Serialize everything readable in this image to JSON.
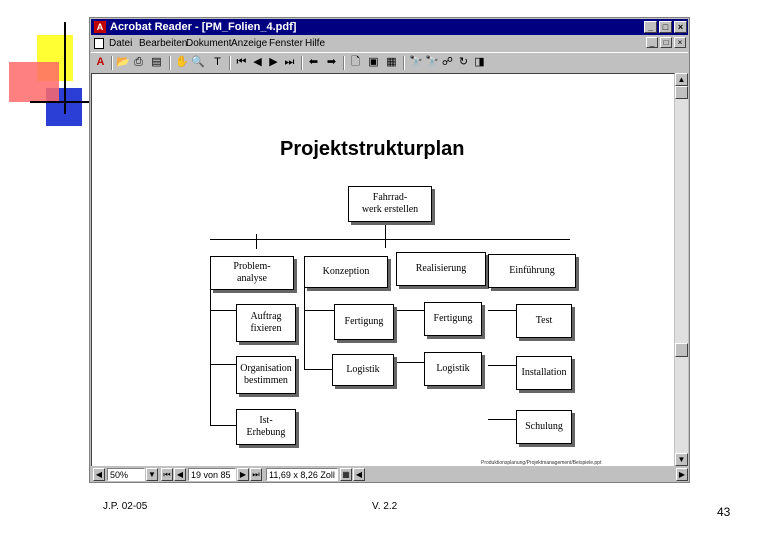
{
  "window": {
    "title": "Acrobat Reader - [PM_Folien_4.pdf]",
    "app_icon": "acrobat-icon",
    "controls": [
      "_",
      "□",
      "×"
    ]
  },
  "menu": {
    "items": [
      "Datei",
      "Bearbeiten",
      "Dokument",
      "Anzeige",
      "Fenster",
      "Hilfe"
    ]
  },
  "document": {
    "page_title": "Projektstrukturplan",
    "root": "Fahrrad-\nwerk erstellen",
    "columns": {
      "col1": {
        "head": "Problem-\nanalyse",
        "children": [
          "Auftrag\nfixieren",
          "Organisation\nbestimmen",
          "Ist-\nErhebung"
        ]
      },
      "col2": {
        "head": "Konzeption",
        "children": [
          "Fertigung",
          "Logistik"
        ]
      },
      "col3": {
        "head": "Realisierung",
        "children": [
          "Fertigung",
          "Logistik"
        ]
      },
      "col4": {
        "head": "Einführung",
        "children": [
          "Test",
          "Installation",
          "Schulung"
        ]
      }
    },
    "source_note": "Produktionsplanung/Projektmanagement/Beispiele.ppt"
  },
  "status": {
    "zoom": "50%",
    "page": "19 von 85",
    "size": "11,69 x 8,26 Zoll"
  },
  "footer": {
    "left": "J.P. 02-05",
    "center": "V. 2.2",
    "page_number": "43"
  },
  "colors": {
    "titlebar": "#000080",
    "deco_yellow": "#ffff00",
    "deco_red": "#ff6a6a",
    "deco_blue": "#2b3fd6"
  }
}
